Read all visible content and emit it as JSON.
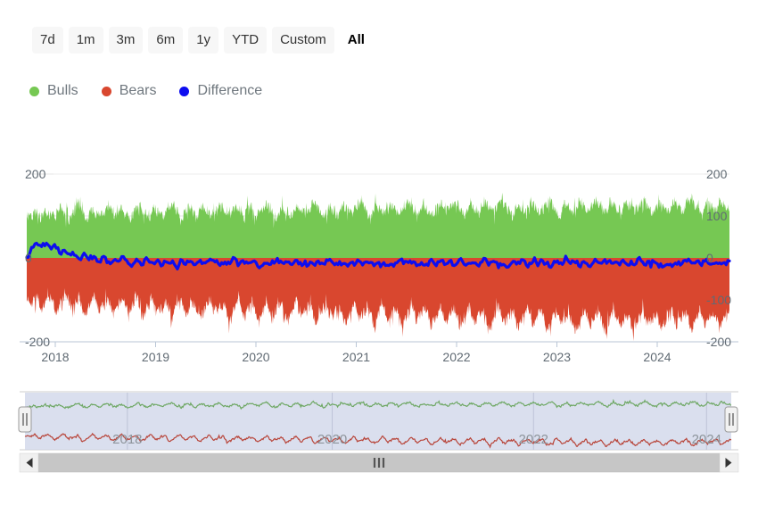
{
  "range_selector": {
    "buttons": [
      {
        "label": "7d",
        "selected": false
      },
      {
        "label": "1m",
        "selected": false
      },
      {
        "label": "3m",
        "selected": false
      },
      {
        "label": "6m",
        "selected": false
      },
      {
        "label": "1y",
        "selected": false
      },
      {
        "label": "YTD",
        "selected": false
      },
      {
        "label": "Custom",
        "selected": false
      },
      {
        "label": "All",
        "selected": true
      }
    ]
  },
  "legend": {
    "items": [
      {
        "label": "Bulls",
        "color": "#76c853"
      },
      {
        "label": "Bears",
        "color": "#d9472f"
      },
      {
        "label": "Difference",
        "color": "#0d0df0"
      }
    ]
  },
  "scrollbar": {
    "left_arrow_icon": "triangle-left-icon",
    "right_arrow_icon": "triangle-right-icon",
    "grip_icon": "grip-lines-icon"
  },
  "navigator": {
    "left_handle_icon": "navigator-handle-left-icon",
    "right_handle_icon": "navigator-handle-right-icon",
    "year_labels": [
      "2018",
      "2020",
      "2022",
      "2024"
    ],
    "mask_color": "#ccd3e8",
    "bulls_color": "#6fa865",
    "bears_color": "#b8453a"
  },
  "chart_data": {
    "type": "area",
    "title": "",
    "subtitle": "",
    "xlabel": "",
    "ylabel": "",
    "x_tick_labels": [
      "2018",
      "2019",
      "2020",
      "2021",
      "2022",
      "2023",
      "2024"
    ],
    "x_range": [
      "2017-09",
      "2024-07"
    ],
    "y_left_ticks": [
      200,
      0,
      -200
    ],
    "y_right_ticks": [
      200,
      100,
      0,
      -100,
      -200
    ],
    "ylim": [
      -200,
      200
    ],
    "grid": true,
    "legend_position": "top-left",
    "series": [
      {
        "name": "Bulls",
        "color": "#76c853",
        "type": "area",
        "mean": 110,
        "min": 60,
        "max": 175,
        "values": [
          96,
          101,
          108,
          95,
          112,
          103,
          99,
          118,
          106,
          93,
          110,
          122,
          104,
          97,
          115,
          108,
          101,
          125,
          112,
          99,
          118,
          107,
          94,
          113,
          126,
          105,
          98,
          120,
          109,
          102,
          116,
          130,
          108,
          96,
          119,
          111,
          100,
          123,
          114,
          103,
          117,
          128,
          106,
          99,
          121,
          112,
          101,
          124,
          115,
          104,
          118,
          131,
          109,
          97,
          122,
          113,
          102,
          126,
          116,
          105,
          119,
          133,
          110,
          98,
          123,
          114,
          103,
          127,
          117,
          106,
          120,
          134,
          111,
          99,
          124,
          115,
          104,
          128,
          118,
          107,
          121,
          135,
          112,
          100,
          125,
          116,
          105,
          129,
          119,
          108,
          122,
          136,
          113,
          101,
          126,
          117,
          106,
          130,
          120,
          109,
          123,
          137,
          114,
          102,
          127,
          118,
          107,
          131,
          121,
          110,
          124,
          138,
          115,
          103,
          128,
          119,
          108,
          132,
          122,
          111,
          125,
          139,
          116,
          104,
          129,
          120,
          109,
          133,
          123,
          112,
          126,
          140,
          117,
          105,
          130,
          121,
          110,
          134,
          124,
          113,
          127,
          141,
          118,
          106,
          131,
          122,
          111,
          135,
          125,
          114
        ]
      },
      {
        "name": "Bears",
        "color": "#d9472f",
        "type": "area",
        "mean": -108,
        "min": -175,
        "max": -55,
        "values": [
          -98,
          -112,
          -88,
          -125,
          -101,
          -94,
          -133,
          -110,
          -86,
          -121,
          -105,
          -97,
          -140,
          -115,
          -90,
          -128,
          -108,
          -99,
          -136,
          -118,
          -92,
          -130,
          -111,
          -101,
          -143,
          -120,
          -94,
          -132,
          -113,
          -103,
          -145,
          -122,
          -96,
          -134,
          -115,
          -105,
          -147,
          -124,
          -98,
          -136,
          -117,
          -107,
          -149,
          -126,
          -100,
          -138,
          -119,
          -109,
          -151,
          -128,
          -102,
          -140,
          -121,
          -111,
          -153,
          -130,
          -104,
          -142,
          -123,
          -113,
          -155,
          -132,
          -106,
          -144,
          -125,
          -115,
          -157,
          -134,
          -108,
          -146,
          -127,
          -117,
          -159,
          -136,
          -110,
          -148,
          -129,
          -119,
          -161,
          -138,
          -112,
          -150,
          -131,
          -121,
          -163,
          -140,
          -114,
          -152,
          -133,
          -123,
          -165,
          -142,
          -116,
          -154,
          -135,
          -125,
          -167,
          -144,
          -118,
          -156,
          -137,
          -127,
          -169,
          -146,
          -120,
          -158,
          -139,
          -129,
          -171,
          -148,
          -122,
          -160,
          -141,
          -131,
          -173,
          -150,
          -124,
          -162,
          -143,
          -133,
          -175,
          -152,
          -126,
          -164,
          -145,
          -135,
          -174,
          -151,
          -128,
          -163,
          -144,
          -134,
          -172,
          -149,
          -127,
          -161,
          -142,
          -132,
          -170,
          -147,
          -125,
          -159,
          -140,
          -130,
          -168,
          -145,
          -123
        ]
      },
      {
        "name": "Difference",
        "color": "#0d0df0",
        "type": "line",
        "mean": -5,
        "min": -35,
        "max": 45,
        "values": [
          2,
          18,
          40,
          28,
          35,
          22,
          30,
          12,
          20,
          5,
          14,
          -2,
          8,
          -6,
          4,
          -10,
          2,
          -14,
          -4,
          -16,
          0,
          -12,
          -18,
          -6,
          -14,
          -2,
          -16,
          -8,
          -18,
          -4,
          -12,
          -20,
          -6,
          -16,
          -2,
          -14,
          -8,
          -18,
          -4,
          -12,
          -20,
          -6,
          -16,
          -2,
          -14,
          -8,
          -18,
          -4,
          -12,
          -20,
          -6,
          -16,
          -2,
          -14,
          -8,
          -18,
          -4,
          -12,
          -22,
          -8,
          -16,
          -4,
          -14,
          -6,
          -18,
          -10,
          -20,
          -6,
          -14,
          -2,
          -16,
          -8,
          -18,
          -4,
          -12,
          -20,
          -6,
          -16,
          -2,
          -14,
          -8,
          -18,
          -10,
          -20,
          -6,
          -16,
          -4,
          -14,
          -8,
          -18,
          -2,
          -12,
          -20,
          -6,
          -16,
          -4,
          -14,
          -8,
          -18,
          -10,
          -20,
          -6,
          -16,
          -2,
          -14,
          -8,
          -18,
          -4,
          -12,
          -20,
          -6,
          -16,
          -2,
          -14,
          -8,
          -18,
          -10,
          -20,
          -6,
          -16,
          -4,
          -14,
          -8,
          -18,
          -2,
          -12,
          -20,
          -6,
          -16,
          -4,
          -14,
          -8,
          -18,
          -10,
          -20,
          -6,
          -16,
          -2,
          -14,
          -8,
          -18,
          -4,
          -12,
          -20,
          -6,
          -16,
          -8
        ]
      }
    ]
  }
}
